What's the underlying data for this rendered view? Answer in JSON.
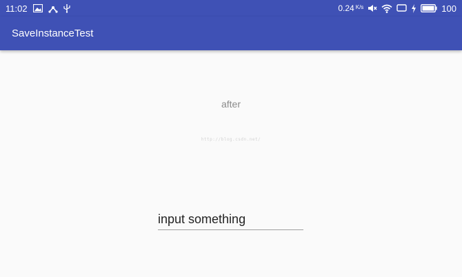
{
  "status_bar": {
    "time": "11:02",
    "net_speed_value": "0.24",
    "net_speed_unit": "K/s",
    "battery_percent": "100"
  },
  "app_bar": {
    "title": "SaveInstanceTest"
  },
  "main": {
    "result_text": "after",
    "watermark": "http://blog.csdn.net/",
    "input_value": "input something"
  },
  "colors": {
    "primary": "#3f51b5",
    "background": "#fafafa"
  },
  "icons": {
    "status_left": [
      "image-notification-icon",
      "share-notification-icon",
      "usb-icon"
    ],
    "status_right": [
      "mute-icon",
      "wifi-icon",
      "screen-mirror-icon",
      "charging-icon",
      "battery-icon"
    ]
  }
}
